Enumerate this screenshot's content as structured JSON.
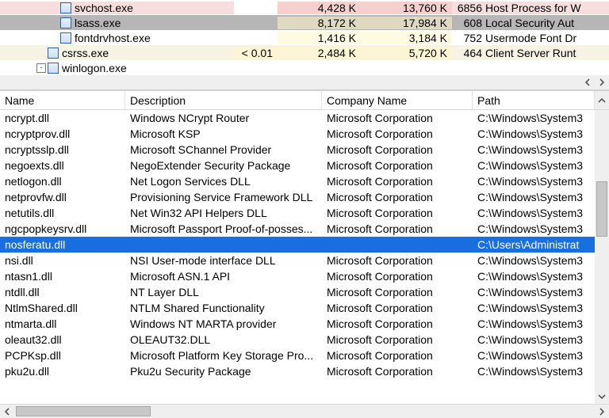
{
  "process_tree": {
    "rows": [
      {
        "indent": 58,
        "toggle": "",
        "icon": true,
        "name": "svchost.exe",
        "cpu": "",
        "pbytes": "4,428 K",
        "wset": "13,760 K",
        "pid": "6856",
        "desc": "Host Process for W",
        "cls": "svchost"
      },
      {
        "indent": 58,
        "toggle": "",
        "icon": true,
        "name": "lsass.exe",
        "cpu": "",
        "pbytes": "8,172 K",
        "wset": "17,984 K",
        "pid": "608",
        "desc": "Local Security Aut",
        "cls": "sel"
      },
      {
        "indent": 58,
        "toggle": "",
        "icon": true,
        "name": "fontdrvhost.exe",
        "cpu": "",
        "pbytes": "1,416 K",
        "wset": "3,184 K",
        "pid": "752",
        "desc": "Usermode Font Dr",
        "cls": ""
      },
      {
        "indent": 42,
        "toggle": "",
        "icon": true,
        "name": "csrss.exe",
        "cpu": "< 0.01",
        "pbytes": "2,484 K",
        "wset": "5,720 K",
        "pid": "464",
        "desc": "Client Server Runt",
        "cls": "csrss"
      },
      {
        "indent": 42,
        "toggle": "-",
        "icon": true,
        "name": "winlogon.exe",
        "cpu": "",
        "pbytes": "",
        "wset": "",
        "pid": "",
        "desc": "",
        "cls": ""
      }
    ]
  },
  "dll_columns": {
    "name": "Name",
    "desc": "Description",
    "company": "Company Name",
    "path": "Path"
  },
  "dll_rows": [
    {
      "name": "ncrypt.dll",
      "desc": "Windows NCrypt Router",
      "company": "Microsoft Corporation",
      "path": "C:\\Windows\\System3"
    },
    {
      "name": "ncryptprov.dll",
      "desc": "Microsoft KSP",
      "company": "Microsoft Corporation",
      "path": "C:\\Windows\\System3"
    },
    {
      "name": "ncryptsslp.dll",
      "desc": "Microsoft SChannel Provider",
      "company": "Microsoft Corporation",
      "path": "C:\\Windows\\System3"
    },
    {
      "name": "negoexts.dll",
      "desc": "NegoExtender Security Package",
      "company": "Microsoft Corporation",
      "path": "C:\\Windows\\System3"
    },
    {
      "name": "netlogon.dll",
      "desc": "Net Logon Services DLL",
      "company": "Microsoft Corporation",
      "path": "C:\\Windows\\System3"
    },
    {
      "name": "netprovfw.dll",
      "desc": "Provisioning Service Framework DLL",
      "company": "Microsoft Corporation",
      "path": "C:\\Windows\\System3"
    },
    {
      "name": "netutils.dll",
      "desc": "Net Win32 API Helpers DLL",
      "company": "Microsoft Corporation",
      "path": "C:\\Windows\\System3"
    },
    {
      "name": "ngcpopkeysrv.dll",
      "desc": "Microsoft Passport Proof-of-posses...",
      "company": "Microsoft Corporation",
      "path": "C:\\Windows\\System3"
    },
    {
      "name": "nosferatu.dll",
      "desc": "",
      "company": "",
      "path": "C:\\Users\\Administrat",
      "sel": true
    },
    {
      "name": "nsi.dll",
      "desc": "NSI User-mode interface DLL",
      "company": "Microsoft Corporation",
      "path": "C:\\Windows\\System3"
    },
    {
      "name": "ntasn1.dll",
      "desc": "Microsoft ASN.1 API",
      "company": "Microsoft Corporation",
      "path": "C:\\Windows\\System3"
    },
    {
      "name": "ntdll.dll",
      "desc": "NT Layer DLL",
      "company": "Microsoft Corporation",
      "path": "C:\\Windows\\System3"
    },
    {
      "name": "NtlmShared.dll",
      "desc": "NTLM Shared Functionality",
      "company": "Microsoft Corporation",
      "path": "C:\\Windows\\System3"
    },
    {
      "name": "ntmarta.dll",
      "desc": "Windows NT MARTA provider",
      "company": "Microsoft Corporation",
      "path": "C:\\Windows\\System3"
    },
    {
      "name": "oleaut32.dll",
      "desc": "OLEAUT32.DLL",
      "company": "Microsoft Corporation",
      "path": "C:\\Windows\\System3"
    },
    {
      "name": "PCPKsp.dll",
      "desc": "Microsoft Platform Key Storage Pro...",
      "company": "Microsoft Corporation",
      "path": "C:\\Windows\\System3"
    },
    {
      "name": "pku2u.dll",
      "desc": "Pku2u Security Package",
      "company": "Microsoft Corporation",
      "path": "C:\\Windows\\System3"
    }
  ]
}
